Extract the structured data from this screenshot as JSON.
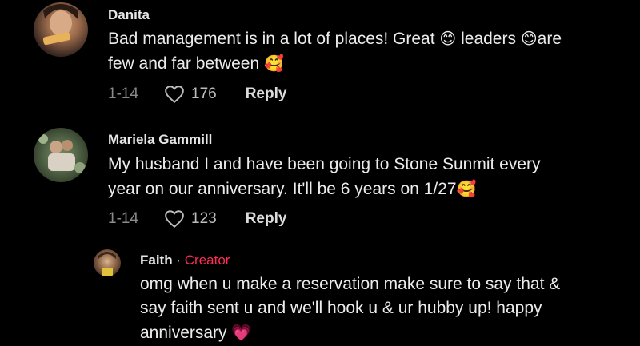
{
  "comments": [
    {
      "author": "Danita",
      "text_line1": "Bad management is in a lot of places! Great ",
      "text_mid": " leaders ",
      "text_after": "are",
      "text_line2": "few and far between ",
      "emoji_smile": "😊",
      "emoji_love": "🥰",
      "date": "1-14",
      "likes": "176",
      "reply_label": "Reply"
    },
    {
      "author": "Mariela Gammill",
      "text_line1": "My husband I and have been going to Stone Sunmit every",
      "text_line2": "year on our anniversary. It'll be 6 years on 1/27",
      "emoji_love": "🥰",
      "date": "1-14",
      "likes": "123",
      "reply_label": "Reply"
    }
  ],
  "reply": {
    "author": "Faith",
    "separator": "·",
    "badge": "Creator",
    "text_line1": "omg when u make a reservation make sure to say that &",
    "text_line2": "say faith sent u and we'll hook u & ur hubby up! happy",
    "text_line3": "anniversary ",
    "emoji_heart": "💗"
  },
  "colors": {
    "background": "#000000",
    "creator_badge": "#fe2c55",
    "muted": "#8a8a8a"
  }
}
